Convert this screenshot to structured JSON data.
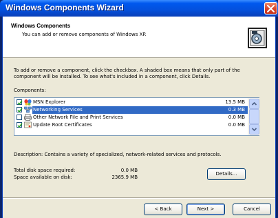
{
  "window": {
    "title": "Windows Components Wizard"
  },
  "header": {
    "title": "Windows Components",
    "subtitle": "You can add or remove components of Windows XP."
  },
  "intro": "To add or remove a component, click the checkbox. A shaded box means that only part of the component will be installed. To see what's included in a component, click Details.",
  "components_label": "Components:",
  "components": [
    {
      "name": "MSN Explorer",
      "size": "13.5 MB",
      "checked": true,
      "icon": "msn-butterfly-icon",
      "selected": false
    },
    {
      "name": "Networking Services",
      "size": "0.3 MB",
      "checked": true,
      "icon": "network-icon",
      "selected": true
    },
    {
      "name": "Other Network File and Print Services",
      "size": "0.0 MB",
      "checked": false,
      "icon": "network-printer-icon",
      "selected": false
    },
    {
      "name": "Update Root Certificates",
      "size": "0.0 MB",
      "checked": true,
      "icon": "certificate-icon",
      "selected": false
    }
  ],
  "description": "Description:  Contains a variety of specialized, network-related services and protocols.",
  "space": {
    "required_label": "Total disk space required:",
    "required_value": "0.0 MB",
    "available_label": "Space available on disk:",
    "available_value": "2365.9 MB"
  },
  "buttons": {
    "details": "Details...",
    "back": "< Back",
    "next": "Next >",
    "cancel": "Cancel"
  },
  "colors": {
    "titlebar": "#0058ee",
    "selection": "#316ac5",
    "dialog_bg": "#ece9d8",
    "close": "#d8442a"
  }
}
